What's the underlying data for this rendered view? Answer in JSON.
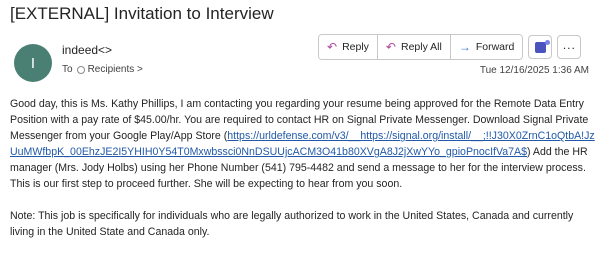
{
  "email": {
    "subject": "[EXTERNAL] Invitation to Interview",
    "avatar_letter": "I",
    "sender_name": "indeed<>",
    "to_label": "To",
    "recipients_label": "Recipients >",
    "timestamp": "Tue 12/16/2025 1:36 AM"
  },
  "toolbar": {
    "reply_label": "Reply",
    "reply_all_label": "Reply All",
    "forward_label": "Forward",
    "teams_icon": "teams-icon",
    "more_label": "...",
    "colors": {
      "reply_icon": "#b1459b",
      "forward_icon": "#3b6fd1",
      "teams": "#4b53bc"
    }
  },
  "body": {
    "para1_text_a": "Good day, this is Ms. Kathy Phillips, I am contacting you regarding your resume being approved for the Remote Data Entry Position with a pay rate of $45.00/hr. You are required to contact HR on Signal Private Messenger. Download Signal Private Messenger from your Google Play/App Store (",
    "para1_link": "https://urldefense.com/v3/__https://signal.org/install/__;!!J30X0ZrnC1oQtbA!JzUuMWfbpK_00EhzJE2I5YHIH0Y54T0Mxwbssci0NnDSUUjcACM3O41b80XVgA8J2jXwYYo_gpioPnocIfVa7A$",
    "para1_text_b": ") Add the HR manager (Mrs. Jody Holbs) using her Phone Number (541) 795-4482 and send a message to her for the interview process. This is our first step to proceed further. She will be expecting to hear from you soon.",
    "para2_text": "Note: This job is specifically for individuals who are legally authorized to work in the United States, Canada and currently living in the United State and Canada only."
  },
  "colors": {
    "avatar_bg": "#4a7f73",
    "link": "#2159a8"
  }
}
